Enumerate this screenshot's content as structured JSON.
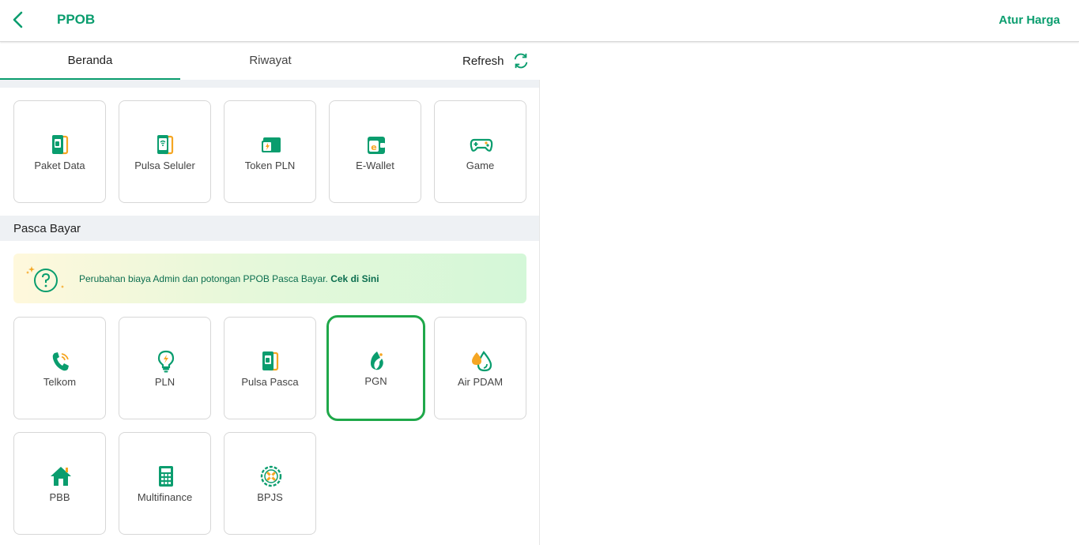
{
  "header": {
    "title": "PPOB",
    "action_label": "Atur Harga"
  },
  "tabs": [
    {
      "label": "Beranda",
      "active": true
    },
    {
      "label": "Riwayat",
      "active": false
    }
  ],
  "refresh_label": "Refresh",
  "prabayar": {
    "items": [
      {
        "label": "Paket Data",
        "icon": "phone-card-icon"
      },
      {
        "label": "Pulsa Seluler",
        "icon": "phone-signal-icon"
      },
      {
        "label": "Token PLN",
        "icon": "electric-token-icon"
      },
      {
        "label": "E-Wallet",
        "icon": "wallet-icon"
      },
      {
        "label": "Game",
        "icon": "gamepad-icon"
      }
    ]
  },
  "pasca": {
    "title": "Pasca Bayar",
    "banner": {
      "text": "Perubahan biaya Admin dan potongan PPOB Pasca Bayar. ",
      "link": "Cek di Sini"
    },
    "items": [
      {
        "label": "Telkom",
        "icon": "telephone-icon"
      },
      {
        "label": "PLN",
        "icon": "lightbulb-icon"
      },
      {
        "label": "Pulsa Pasca",
        "icon": "phone-card-icon"
      },
      {
        "label": "PGN",
        "icon": "gas-flame-icon",
        "highlighted": true
      },
      {
        "label": "Air PDAM",
        "icon": "water-drop-icon"
      },
      {
        "label": "PBB",
        "icon": "house-icon"
      },
      {
        "label": "Multifinance",
        "icon": "calculator-icon"
      },
      {
        "label": "BPJS",
        "icon": "bpjs-icon"
      }
    ]
  },
  "colors": {
    "primary": "#0a9d6e",
    "accent": "#f5a623",
    "highlight_border": "#1fa84a",
    "section_bg": "#eef1f4"
  }
}
